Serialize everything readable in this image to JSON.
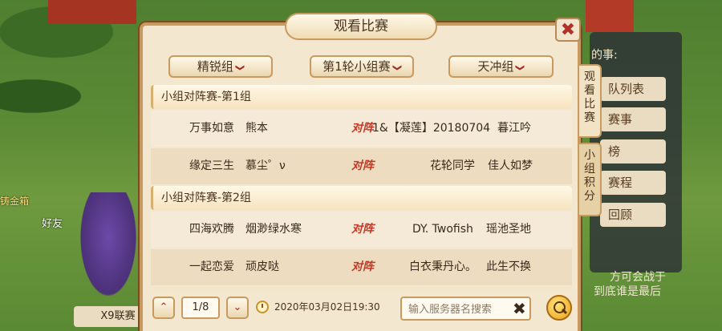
{
  "dialog": {
    "title": "观看比赛",
    "close_label": "✖"
  },
  "filters": {
    "division": "精锐组",
    "round": "第1轮小组赛",
    "group": "天冲组",
    "chevron": "❯"
  },
  "side_tabs": {
    "watch": "观看比赛",
    "points": "小组积分"
  },
  "groups": [
    {
      "title": "小组对阵赛-第1组",
      "matches": [
        {
          "team_a": "万事如意",
          "player_a": "熊本",
          "vs": "对阵",
          "team_b": "1&【凝莲】20180704",
          "player_b": "暮江吟"
        },
        {
          "team_a": "缘定三生",
          "player_a": "慕尘゜ν",
          "vs": "对阵",
          "team_b": "花轮同学",
          "player_b": "佳人如梦"
        }
      ]
    },
    {
      "title": "小组对阵赛-第2组",
      "matches": [
        {
          "team_a": "四海欢腾",
          "player_a": "烟渺绿水寒",
          "vs": "对阵",
          "team_b": "DY. Twofish",
          "player_b": "瑶池圣地"
        },
        {
          "team_a": "一起恋爱",
          "player_a": "顽皮哒",
          "vs": "对阵",
          "team_b": "白衣秉丹心。",
          "player_b": "此生不换"
        }
      ]
    }
  ],
  "pagination": {
    "up": "⌃",
    "down": "⌄",
    "page": "1/8"
  },
  "match_time": "2020年03月02日19:30",
  "search": {
    "placeholder": "输入服务器名搜索",
    "clear": "✖"
  },
  "background": {
    "right_panel_title": "的事:",
    "right_items": [
      "队列表",
      "赛事",
      "榜",
      "赛程",
      "回顾"
    ],
    "right_text_1": "方可会战于",
    "right_text_2": "到底谁是最后",
    "friend_label": "好友",
    "left_label": "铸金箱",
    "bottom_button": "X9联赛"
  }
}
